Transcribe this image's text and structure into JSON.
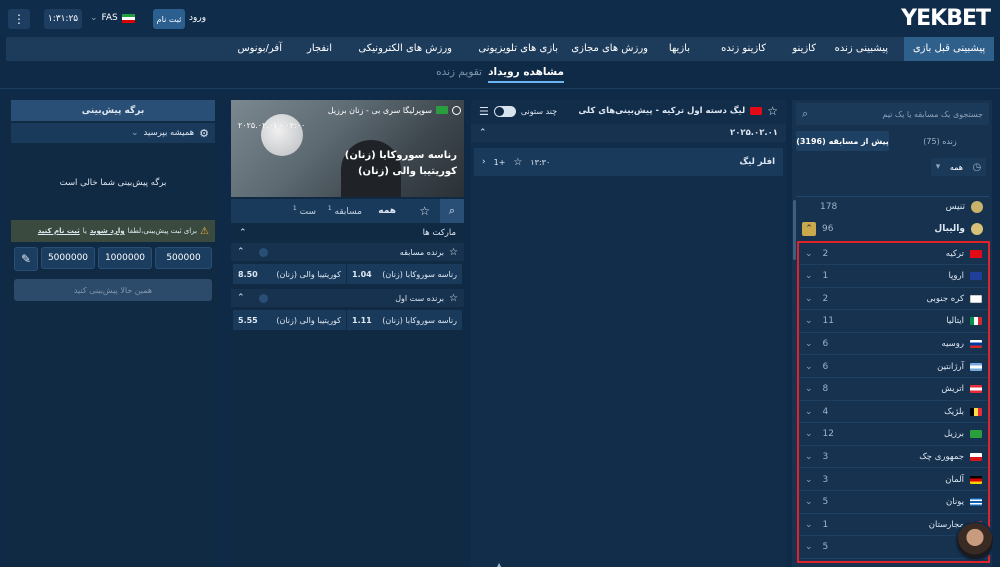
{
  "header": {
    "logo_main": "YEK",
    "logo_accent": "BET",
    "login": "ورود",
    "signup": "ثبت نام",
    "language": "FAS",
    "time": "۱:۳۱:۲۵"
  },
  "nav": {
    "items": [
      {
        "label": "پیشبینی قبل بازی"
      },
      {
        "label": "پیشبینی زنده"
      },
      {
        "label": "کازینو"
      },
      {
        "label": "کازینو زنده"
      },
      {
        "label": "بازیها"
      },
      {
        "label": "ورزش های مجازی"
      },
      {
        "label": "بازی های تلویزیونی"
      },
      {
        "label": "ورزش های الکترونیکی"
      },
      {
        "label": "انفجار"
      },
      {
        "label": "آفر/بونوس"
      }
    ]
  },
  "subtabs": {
    "events": "مشاهده رویداد",
    "live_calendar": "تقویم زنده"
  },
  "left_sidebar": {
    "search_placeholder": "جستجوی یک مسابقه یا یک تیم",
    "tab_live": "زنده (75)",
    "tab_prematch": "پیش از مسابقه (3196)",
    "filter_all": "همه",
    "sports": [
      {
        "name": "تنیس",
        "count": "178"
      },
      {
        "name": "والیبال",
        "count": "96"
      }
    ],
    "countries": [
      {
        "name": "ترکیه",
        "count": "2",
        "flag": "tr"
      },
      {
        "name": "اروپا",
        "count": "1",
        "flag": "eu"
      },
      {
        "name": "کره جنوبی",
        "count": "2",
        "flag": "kr"
      },
      {
        "name": "ایتالیا",
        "count": "11",
        "flag": "it"
      },
      {
        "name": "روسیه",
        "count": "6",
        "flag": "ru"
      },
      {
        "name": "آرژانتین",
        "count": "6",
        "flag": "ar"
      },
      {
        "name": "اتریش",
        "count": "8",
        "flag": "at"
      },
      {
        "name": "بلژیک",
        "count": "4",
        "flag": "be"
      },
      {
        "name": "برزیل",
        "count": "12",
        "flag": "br"
      },
      {
        "name": "جمهوری چک",
        "count": "3",
        "flag": "cz"
      },
      {
        "name": "آلمان",
        "count": "3",
        "flag": "de"
      },
      {
        "name": "یونان",
        "count": "5",
        "flag": "gr"
      },
      {
        "name": "مجارستان",
        "count": "1",
        "flag": "hu"
      },
      {
        "name": "",
        "count": "5",
        "flag": ""
      }
    ]
  },
  "middle_left": {
    "league_title": "لیگ دسته اول ترکیه - پیش‌بینی‌های کلی",
    "multi_column": "چند ستونی",
    "date": "۲۰۲۵.۰۲.۰۱",
    "event_title": "افلر لیگ",
    "event_time": "۱۳:۳۰",
    "event_more": "1+"
  },
  "event_panel": {
    "league": "سوپرلیگا سری بی - زنان برزیل",
    "datetime": "۲۰۲۵.۰۲.۰۱ - ۰۲:۰۰",
    "team1": "رناسه سوروکابا (زنان)",
    "team2": "کوریتیبا والی (زنان)",
    "tab_all": "همه",
    "tab_match": "مسابقه",
    "tab_match_count": "1",
    "tab_set": "ست",
    "tab_set_count": "1",
    "markets_label": "مارکت ها",
    "markets": [
      {
        "title": "برنده مسابقه",
        "home": "رناسه سوروکابا (زنان)",
        "home_odd": "1.04",
        "away": "کوریتیبا والی (زنان)",
        "away_odd": "8.50"
      },
      {
        "title": "برنده ست اول",
        "home": "رناسه سوروکابا (زنان)",
        "home_odd": "1.11",
        "away": "کوریتیبا والی (زنان)",
        "away_odd": "5.55"
      }
    ]
  },
  "betslip": {
    "title": "برگه پیش‌بینی",
    "always_ask": "همیشه بپرسید",
    "empty": "برگه پیش‌بینی شما خالی است",
    "notice_prefix": "برای ثبت پیش‌بینی،لطفا",
    "notice_login": "وارد شوید",
    "notice_or": "یا",
    "notice_signup": "ثبت نام کنید",
    "stakes": [
      "500000",
      "1000000",
      "5000000"
    ],
    "place_now": "همین حالا پیش‌بینی کنید"
  },
  "colors": {
    "accent": "#2f5f8b",
    "highlight_border": "#e0222a",
    "background": "#0e2a47"
  }
}
